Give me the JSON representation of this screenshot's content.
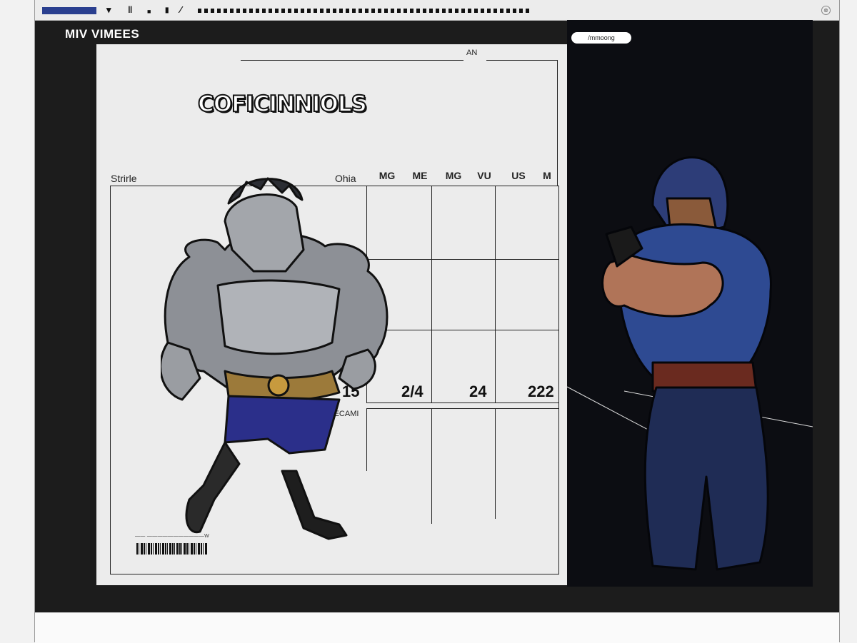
{
  "app": {
    "title": "MIV VIMEES"
  },
  "toolbar": {
    "icons": [
      "chevron-down-icon",
      "columns-icon",
      "square-icon",
      "bar-icon",
      "pen-icon"
    ]
  },
  "document": {
    "top_ref": "AN",
    "logo_text": "COFICINNIOLS",
    "left_label": "Strirle",
    "mid_label": "Ohia",
    "columns": [
      "MG",
      "ME",
      "MG",
      "VU",
      "US",
      "M"
    ],
    "numbers": [
      "15",
      "2/4",
      "24",
      "222"
    ],
    "section_label": "XATECAMI",
    "small_text": "—— ———————————W"
  },
  "right_panel": {
    "pill_label": "/mmoong"
  },
  "colors": {
    "accent": "#2a3f8f",
    "right_bg": "#0c0d12",
    "doc_bg": "#ececec"
  }
}
